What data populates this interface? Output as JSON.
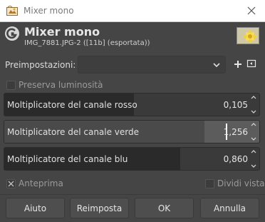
{
  "window": {
    "title": "Mixer mono",
    "app_icon": "gimp-wilber-icon",
    "close_icon": "close-icon"
  },
  "header": {
    "title": "Mixer mono",
    "subtitle": "IMG_7881.JPG-2 ([11b] (esportata))",
    "logo_icon": "gegl-logo-icon",
    "thumbnail": "image-thumbnail"
  },
  "presets": {
    "label": "Preimpostazioni:",
    "value": "",
    "add_icon": "plus-icon",
    "menu_icon": "menu-icon"
  },
  "preserve_luminosity": {
    "label": "Preserva luminosità",
    "checked": false
  },
  "channels": [
    {
      "label": "Moltiplicatore del canale rosso",
      "value": "0,105",
      "level": 0.5
    },
    {
      "label": "Moltiplicatore del canale verde",
      "value": "1,256",
      "level": 0.79
    },
    {
      "label": "Moltiplicatore del canale blu",
      "value": "0,860",
      "level": 0.7
    }
  ],
  "preview": {
    "label": "Anteprima",
    "checked": true
  },
  "split_view": {
    "label": "Dividi vista",
    "checked": false
  },
  "buttons": {
    "help": "Aiuto",
    "reset": "Reimposta",
    "ok": "OK",
    "cancel": "Annulla"
  },
  "colors": {
    "background": "#454545",
    "titlebar": "#ffffff",
    "text": "#dcdcdc"
  }
}
